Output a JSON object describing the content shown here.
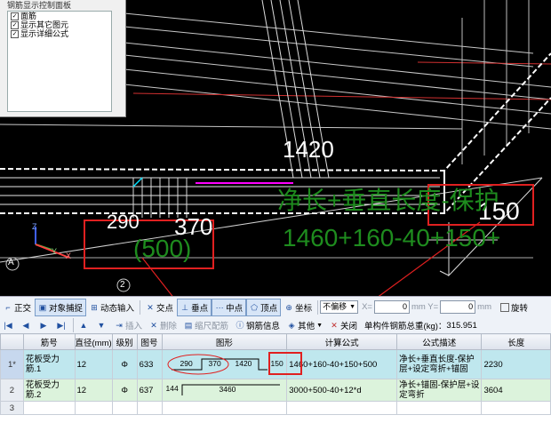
{
  "panel": {
    "title": "钢筋显示控制面板",
    "options": [
      {
        "label": "面筋",
        "checked": true
      },
      {
        "label": "显示其它图元",
        "checked": true
      },
      {
        "label": "显示详细公式",
        "checked": true
      }
    ]
  },
  "viewport": {
    "dim_1420": "1420",
    "dim_290": "290",
    "dim_370": "370",
    "dim_500": "(500)",
    "dim_150": "150",
    "overlay_formula_desc": "净长+垂直长度-保护",
    "overlay_formula": "1460+160-40+150+",
    "axis_a": "A",
    "axis_2": "2",
    "axis_z": "Z",
    "axis_y": "Y",
    "axis_x": "X"
  },
  "toolbar": {
    "ortho": "正交",
    "snap": "对象捕捉",
    "dynamic_input": "动态输入",
    "intersection": "交点",
    "perpendicular": "垂点",
    "midpoint": "中点",
    "vertex": "顶点",
    "coordinate": "坐标",
    "offset_select": "不偏移",
    "x_label": "X=",
    "x_value": "0",
    "mm1": "mm Y=",
    "y_value": "0",
    "mm2": "mm",
    "rotate": "旋转"
  },
  "toolbar2": {
    "insert": "插入",
    "delete": "删除",
    "scale_rebar": "缩尺配筋",
    "rebar_info": "钢筋信息",
    "other": "其他",
    "close": "关闭",
    "total_weight_label": "单构件钢筋总重(kg)：",
    "total_weight": "315.951"
  },
  "table": {
    "headers": [
      "筋号",
      "直径(mm)",
      "级别",
      "图号",
      "图形",
      "计算公式",
      "公式描述",
      "长度"
    ],
    "rows": [
      {
        "num": "1*",
        "name": "花板受力筋.1",
        "diameter": "12",
        "grade": "Φ",
        "fig_no": "633",
        "shape_a": "290",
        "shape_b": "370",
        "shape_c": "1420",
        "shape_d": "150",
        "formula": "1460+160-40+150+500",
        "desc": "净长+垂直长度-保护层+设定弯折+锚固",
        "length": "2230"
      },
      {
        "num": "2",
        "name": "花板受力筋.2",
        "diameter": "12",
        "grade": "Φ",
        "fig_no": "637",
        "shape_a": "144",
        "shape_b": "3460",
        "formula": "3000+500-40+12*d",
        "desc": "净长+锚固-保护层+设定弯折",
        "length": "3604"
      },
      {
        "num": "3"
      }
    ]
  },
  "colors": {
    "annotation_red": "#e02020",
    "overlay_green": "#1e8c1e",
    "row1_bg": "#bfe7ee",
    "row2_bg": "#dcf3dc"
  }
}
